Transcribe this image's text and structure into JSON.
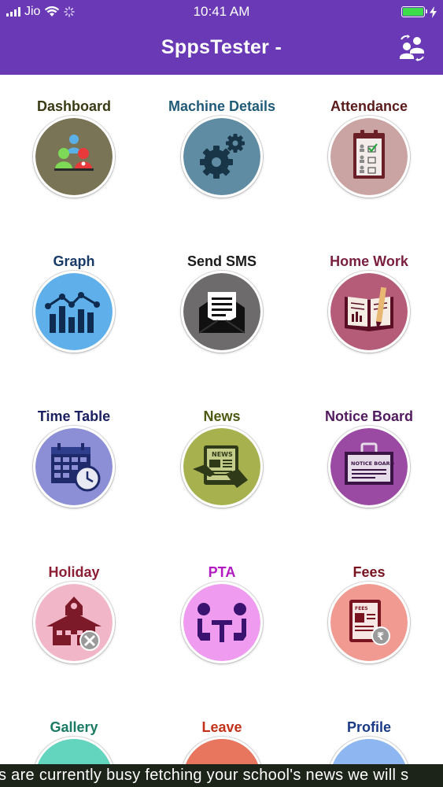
{
  "status_bar": {
    "carrier": "Jio",
    "time": "10:41 AM"
  },
  "header": {
    "title": "SppsTester -"
  },
  "tiles": [
    {
      "label": "Dashboard",
      "icon": "dashboard-icon",
      "label_color": "#3a3a14",
      "circle_color": "#7a7456"
    },
    {
      "label": "Machine Details",
      "icon": "gears-icon",
      "label_color": "#1f5b78",
      "circle_color": "#5f8ca2"
    },
    {
      "label": "Attendance",
      "icon": "attendance-clipboard-icon",
      "label_color": "#5a1a1a",
      "circle_color": "#c9a4a2"
    },
    {
      "label": "Graph",
      "icon": "graph-icon",
      "label_color": "#183a66",
      "circle_color": "#5fb0ea"
    },
    {
      "label": "Send SMS",
      "icon": "envelope-icon",
      "label_color": "#1b1b1b",
      "circle_color": "#6e6b6d"
    },
    {
      "label": "Home Work",
      "icon": "book-pencil-icon",
      "label_color": "#7a1f3f",
      "circle_color": "#b45c78"
    },
    {
      "label": "Time Table",
      "icon": "calendar-clock-icon",
      "label_color": "#1a2060",
      "circle_color": "#8d8fd6"
    },
    {
      "label": "News",
      "icon": "news-tablet-icon",
      "label_color": "#4d5a12",
      "circle_color": "#a7b24f"
    },
    {
      "label": "Notice Board",
      "icon": "notice-board-icon",
      "label_color": "#521a5e",
      "circle_color": "#9a4aa3"
    },
    {
      "label": "Holiday",
      "icon": "school-closed-icon",
      "label_color": "#8c1f35",
      "circle_color": "#f2b6c9"
    },
    {
      "label": "PTA",
      "icon": "meeting-icon",
      "label_color": "#b21ac2",
      "circle_color": "#ef9bef"
    },
    {
      "label": "Fees",
      "icon": "fees-receipt-icon",
      "label_color": "#7a1320",
      "circle_color": "#f19a92"
    },
    {
      "label": "Gallery",
      "icon": "gallery-icon",
      "label_color": "#1b7a64",
      "circle_color": "#63d4bd"
    },
    {
      "label": "Leave",
      "icon": "leave-icon",
      "label_color": "#c2321a",
      "circle_color": "#e8765f"
    },
    {
      "label": "Profile",
      "icon": "profile-icon",
      "label_color": "#1a3a85",
      "circle_color": "#8eb6f0"
    }
  ],
  "ticker": {
    "text": "s are currently busy fetching your school's news we will s"
  }
}
